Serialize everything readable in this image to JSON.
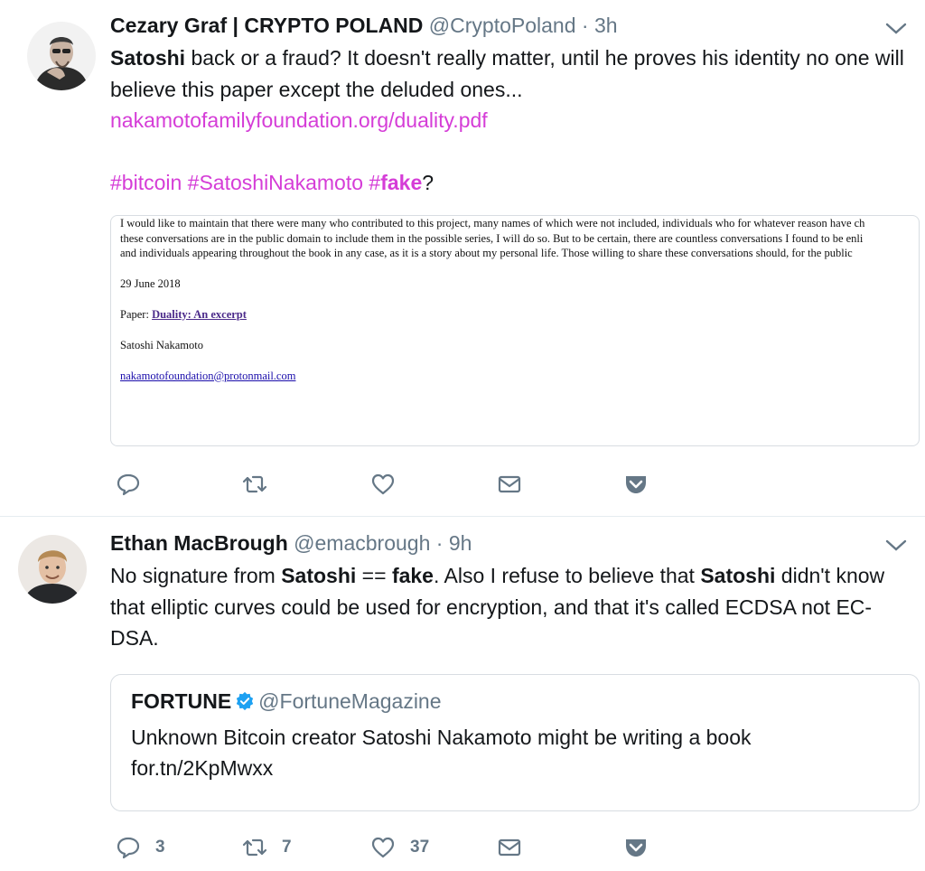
{
  "tweets": [
    {
      "name": "Cezary Graf | CRYPTO POLAND",
      "handle": "@CryptoPoland",
      "dot": "·",
      "time": "3h",
      "body": {
        "bold1": "Satoshi",
        "text1": " back or a fraud? It doesn't really matter, until he proves his identity no one will believe this paper except the deluded ones...",
        "link": "nakamotofamilyfoundation.org/duality.pdf",
        "hash1": "#bitcoin",
        "hash2": "#SatoshiNakamoto",
        "hash3_prefix": "#",
        "hash3_bold": "fake",
        "hash3_suffix": "?"
      },
      "card": {
        "line1": "I would like to maintain that there were many who contributed to this project, many names of which were not included, individuals who for whatever reason have ch",
        "line2": "these conversations are in the public domain to include them in the possible series, I will do so. But to be certain, there are countless conversations I found to be enli",
        "line3": "and individuals appearing throughout the book in any case, as it is a story about my personal life. Those willing to share these conversations should, for the public",
        "date": "29 June 2018",
        "paper_label": "Paper: ",
        "paper_link": "Duality: An excerpt",
        "author": "Satoshi Nakamoto",
        "email": "nakamotofoundation@protonmail.com"
      },
      "actions": {
        "reply": "",
        "retweet": "",
        "like": ""
      }
    },
    {
      "name": "Ethan MacBrough",
      "handle": "@emacbrough",
      "dot": "·",
      "time": "9h",
      "body": {
        "t1": "No signature from ",
        "b1": "Satoshi",
        "t2": " == ",
        "b2": "fake",
        "t3": ". Also I refuse to believe that ",
        "b3": "Satoshi",
        "t4": " didn't know that elliptic curves could be used for encryption, and that it's called ECDSA not EC-DSA."
      },
      "quote": {
        "name": "FORTUNE",
        "handle": "@FortuneMagazine",
        "text": "Unknown Bitcoin creator Satoshi Nakamoto might be writing a book",
        "link": "for.tn/2KpMwxx"
      },
      "actions": {
        "reply": "3",
        "retweet": "7",
        "like": "37"
      }
    }
  ],
  "colors": {
    "link": "#d53dd7",
    "secondary": "#657786",
    "icon": "#657786",
    "verified": "#1da1f2"
  },
  "icons": [
    "reply-icon",
    "retweet-icon",
    "like-icon",
    "dm-icon",
    "pocket-icon",
    "chevron-down-icon",
    "verified-icon"
  ]
}
